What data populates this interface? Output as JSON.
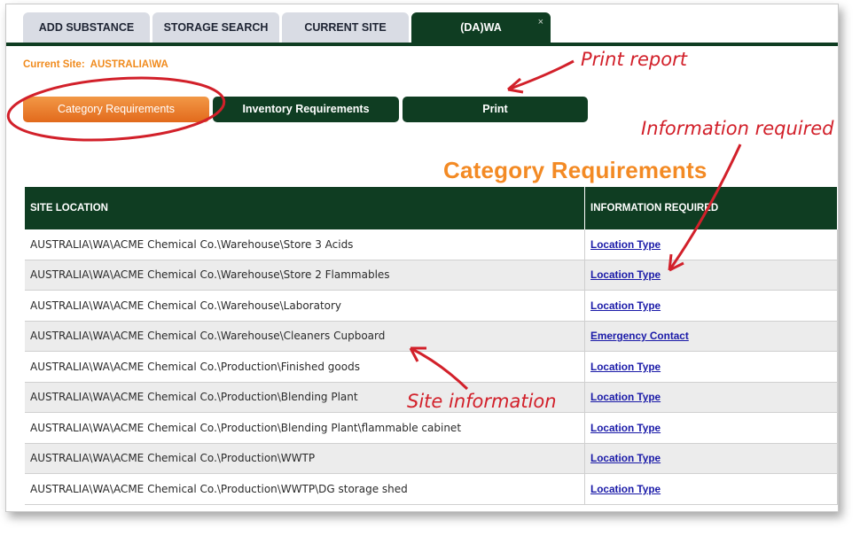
{
  "tabs": [
    {
      "label": "ADD SUBSTANCE",
      "active": false
    },
    {
      "label": "STORAGE SEARCH",
      "active": false
    },
    {
      "label": "CURRENT SITE",
      "active": false
    },
    {
      "label": "(DA)WA",
      "active": true,
      "close": "×"
    }
  ],
  "current_site": {
    "label": "Current Site:",
    "value": "AUSTRALIA\\WA"
  },
  "buttons": {
    "category": "Category Requirements",
    "inventory": "Inventory Requirements",
    "print": "Print"
  },
  "section_title": "Category Requirements",
  "table": {
    "headers": [
      "SITE LOCATION",
      "INFORMATION REQUIRED"
    ],
    "rows": [
      {
        "location": "AUSTRALIA\\WA\\ACME Chemical Co.\\Warehouse\\Store 3 Acids",
        "info": "Location Type"
      },
      {
        "location": "AUSTRALIA\\WA\\ACME Chemical Co.\\Warehouse\\Store 2 Flammables",
        "info": "Location Type"
      },
      {
        "location": "AUSTRALIA\\WA\\ACME Chemical Co.\\Warehouse\\Laboratory",
        "info": "Location Type"
      },
      {
        "location": "AUSTRALIA\\WA\\ACME Chemical Co.\\Warehouse\\Cleaners Cupboard",
        "info": "Emergency Contact"
      },
      {
        "location": "AUSTRALIA\\WA\\ACME Chemical Co.\\Production\\Finished goods",
        "info": "Location Type"
      },
      {
        "location": "AUSTRALIA\\WA\\ACME Chemical Co.\\Production\\Blending Plant",
        "info": "Location Type"
      },
      {
        "location": "AUSTRALIA\\WA\\ACME Chemical Co.\\Production\\Blending Plant\\flammable cabinet",
        "info": "Location Type"
      },
      {
        "location": "AUSTRALIA\\WA\\ACME Chemical Co.\\Production\\WWTP",
        "info": "Location Type"
      },
      {
        "location": "AUSTRALIA\\WA\\ACME Chemical Co.\\Production\\WWTP\\DG storage shed",
        "info": "Location Type"
      }
    ]
  },
  "annotations": {
    "print_report": "Print report",
    "information_required": "Information required",
    "site_information": "Site information"
  },
  "colors": {
    "brand_green": "#0f3d22",
    "accent_orange": "#f38a24",
    "annotation_red": "#d2202a",
    "link_blue": "#1a1aa8"
  }
}
